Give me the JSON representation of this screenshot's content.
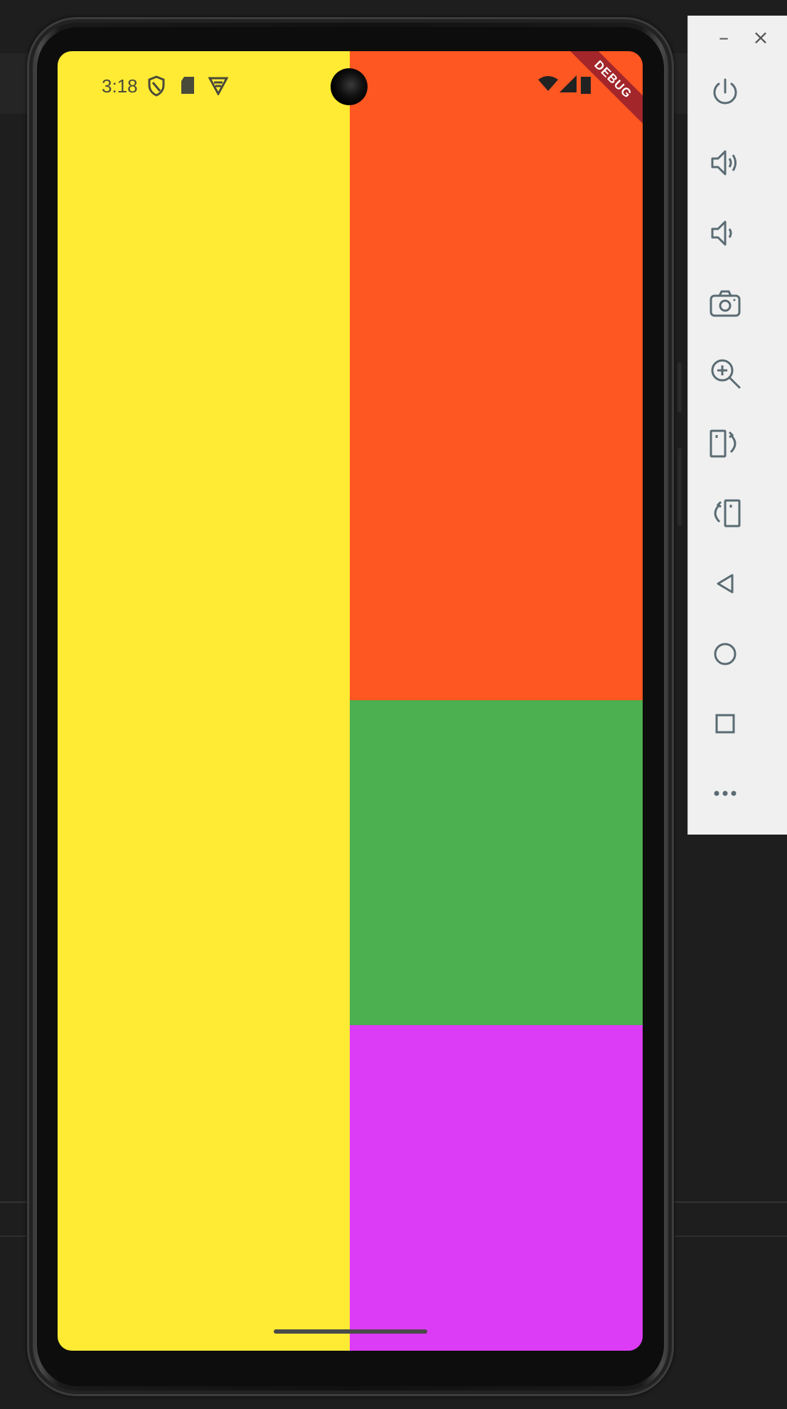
{
  "colors": {
    "pane_left": "#FFEB33",
    "pane_top_right": "#FF5722",
    "pane_mid_right": "#4CAF50",
    "pane_bottom_right": "#DC3CF5",
    "debug_ribbon": "#A3262A",
    "toolbar_bg": "#F0F0F0",
    "toolbar_icon": "#5A6B73"
  },
  "status_bar": {
    "time": "3:18",
    "left_icons": [
      "shield-icon",
      "sd-card-icon",
      "vpn-icon"
    ],
    "right_icons": [
      "wifi-icon",
      "signal-icon",
      "battery-icon"
    ]
  },
  "debug_banner": {
    "label": "DEBUG"
  },
  "emulator_toolbar": {
    "window_controls": {
      "minimize": "–",
      "close": "×"
    },
    "buttons": [
      {
        "name": "power-button",
        "icon": "power-icon"
      },
      {
        "name": "volume-up-button",
        "icon": "volume-up-icon"
      },
      {
        "name": "volume-down-button",
        "icon": "volume-down-icon"
      },
      {
        "name": "screenshot-button",
        "icon": "camera-icon"
      },
      {
        "name": "zoom-button",
        "icon": "zoom-in-icon"
      },
      {
        "name": "rotate-right-button",
        "icon": "rotate-right-icon"
      },
      {
        "name": "rotate-left-button",
        "icon": "rotate-left-icon"
      },
      {
        "name": "back-button",
        "icon": "back-triangle-icon"
      },
      {
        "name": "home-button",
        "icon": "home-circle-icon"
      },
      {
        "name": "overview-button",
        "icon": "overview-square-icon"
      },
      {
        "name": "more-button",
        "icon": "more-dots-icon"
      }
    ]
  }
}
